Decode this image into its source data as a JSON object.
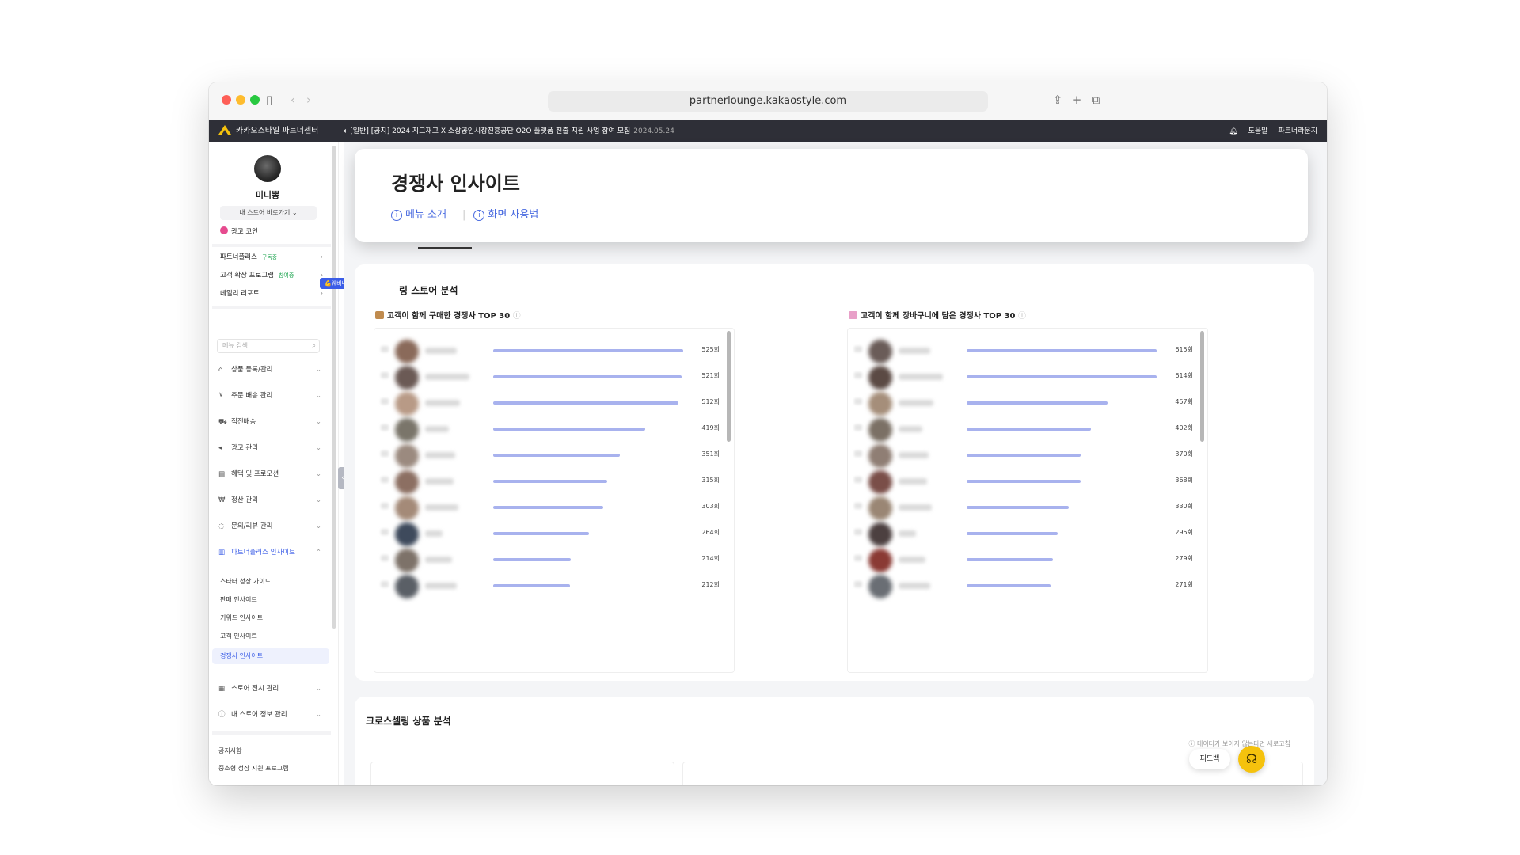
{
  "browser": {
    "url": "partnerlounge.kakaostyle.com"
  },
  "topnav": {
    "brand": "카카오스타일 파트너센터",
    "notice": "[일반] [공지] 2024 지그재그 X 소상공인시장진흥공단 O2O 플랫폼 진출 지원 사업 참여 모집",
    "notice_date": "2024.05.24",
    "help": "도움말",
    "lounge": "파트너라운지"
  },
  "sidebar": {
    "store_name": "미니뽕",
    "store_switch": "내 스토어 바로가기 ⌄",
    "coin": "광고 코인",
    "programs": [
      {
        "label": "파트너플러스",
        "tag": "구독중"
      },
      {
        "label": "고객 확장 프로그램",
        "tag": "참여중"
      },
      {
        "label": "데일리 리포트",
        "tag": ""
      }
    ],
    "tooltip": "💪웨비나 녹화본 공개! ×",
    "search_placeholder": "메뉴 검색",
    "menu": [
      {
        "label": "상품 등록/관리",
        "icon": "hanger-icon"
      },
      {
        "label": "주문 배송 관리",
        "icon": "cart-icon"
      },
      {
        "label": "직진배송",
        "icon": "truck-icon"
      },
      {
        "label": "광고 관리",
        "icon": "megaphone-icon"
      },
      {
        "label": "혜택 및 프로모션",
        "icon": "ticket-icon"
      },
      {
        "label": "정산 관리",
        "icon": "won-icon"
      },
      {
        "label": "문의/리뷰 관리",
        "icon": "chat-icon"
      },
      {
        "label": "파트너플러스 인사이트",
        "icon": "chart-icon"
      }
    ],
    "submenu": [
      "스타터 성장 가이드",
      "판매 인사이트",
      "키워드 인사이트",
      "고객 인사이트",
      "경쟁사 인사이트"
    ],
    "menu2": [
      {
        "label": "스토어 전시 관리",
        "icon": "layout-icon"
      },
      {
        "label": "내 스토어 정보 관리",
        "icon": "info-icon"
      }
    ],
    "footer": [
      "공지사항",
      "중소형 성장 지원 프로그램"
    ]
  },
  "header": {
    "title": "경쟁사 인사이트",
    "link_intro": "메뉴 소개",
    "link_usage": "화면 사용법"
  },
  "cross_store": {
    "title": "크로스셀링 스토어 분석",
    "visible_title": "링 스토어 분석",
    "panel_purchase": {
      "title": "고객이 함께 구매한 경쟁사 TOP 30",
      "counts": [
        "525회",
        "521회",
        "512회",
        "419회",
        "351회",
        "315회",
        "303회",
        "264회",
        "214회",
        "212회"
      ],
      "values": [
        525,
        521,
        512,
        419,
        351,
        315,
        303,
        264,
        214,
        212
      ]
    },
    "panel_cart": {
      "title": "고객이 함께 장바구니에 담은 경쟁사 TOP 30",
      "counts": [
        "615회",
        "614회",
        "457회",
        "402회",
        "370회",
        "368회",
        "330회",
        "295회",
        "279회",
        "271회"
      ],
      "values": [
        615,
        614,
        457,
        402,
        370,
        368,
        330,
        295,
        279,
        271
      ]
    }
  },
  "cross_product": {
    "title": "크로스셀링 상품 분석",
    "hint": "ⓘ 데이터가 보이지 않는다면 새로고침"
  },
  "floating": {
    "feedback": "피드백"
  }
}
